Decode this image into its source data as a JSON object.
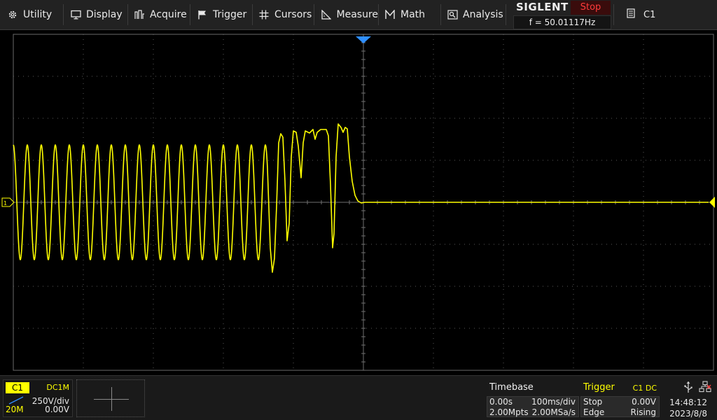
{
  "menu": {
    "items": [
      {
        "id": "utility",
        "label": "Utility",
        "icon": "gear-icon"
      },
      {
        "id": "display",
        "label": "Display",
        "icon": "monitor-icon"
      },
      {
        "id": "acquire",
        "label": "Acquire",
        "icon": "acquire-icon"
      },
      {
        "id": "trigger",
        "label": "Trigger",
        "icon": "flag-icon"
      },
      {
        "id": "cursors",
        "label": "Cursors",
        "icon": "crosshair-icon"
      },
      {
        "id": "measure",
        "label": "Measure",
        "icon": "measure-icon"
      },
      {
        "id": "math",
        "label": "Math",
        "icon": "math-icon"
      },
      {
        "id": "analysis",
        "label": "Analysis",
        "icon": "analysis-icon"
      }
    ]
  },
  "brand": {
    "name": "SIGLENT",
    "run_state": "Stop",
    "frequency": "f = 50.01117Hz"
  },
  "active_channel": {
    "label": "C1",
    "icon": "document-icon"
  },
  "channel1": {
    "label": "C1",
    "coupling": "DC1M",
    "bandwidth": "20M",
    "scale": "250V/div",
    "offset": "0.00V",
    "color": "#ffff00"
  },
  "timebase": {
    "title": "Timebase",
    "delay": "0.00s",
    "scale": "100ms/div",
    "memory_depth": "2.00Mpts",
    "sample_rate": "2.00MSa/s"
  },
  "trigger": {
    "title": "Trigger",
    "source": "C1 DC",
    "mode": "Stop",
    "level": "0.00V",
    "type": "Edge",
    "slope": "Rising"
  },
  "system": {
    "time": "14:48:12",
    "date": "2023/8/8"
  },
  "colors": {
    "trace": "#ffff00",
    "trigger_marker": "#2f8fff",
    "grid": "#5a5a5a"
  }
}
